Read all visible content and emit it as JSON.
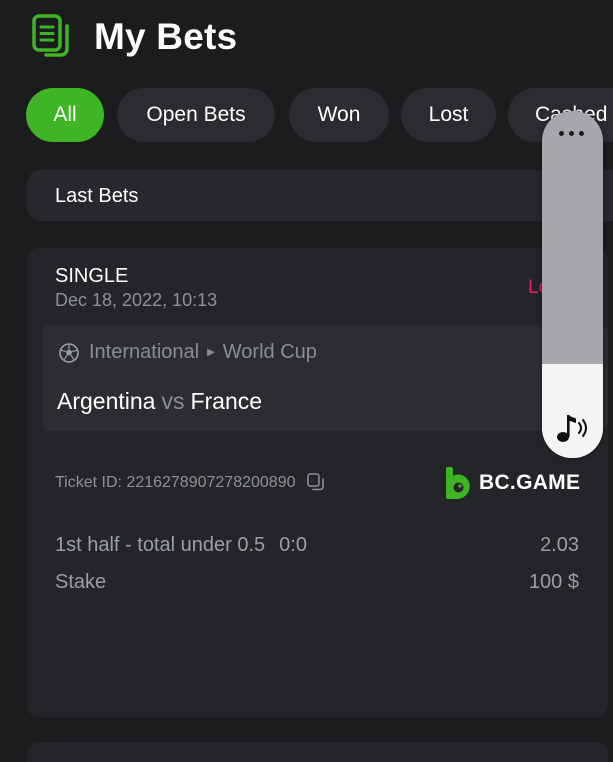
{
  "header": {
    "title": "My Bets",
    "icon": "bets-document-icon"
  },
  "tabs": [
    {
      "label": "All",
      "active": true
    },
    {
      "label": "Open Bets",
      "active": false
    },
    {
      "label": "Won",
      "active": false
    },
    {
      "label": "Lost",
      "active": false
    },
    {
      "label": "Cashed Out",
      "active": false
    }
  ],
  "section": {
    "label": "Last Bets"
  },
  "bet": {
    "type": "SINGLE",
    "date": "Dec 18, 2022, 10:13",
    "status": "Lost",
    "league": {
      "sport_icon": "soccer-ball-icon",
      "category": "International",
      "tournament": "World Cup"
    },
    "teams": {
      "home": "Argentina",
      "vs": "vs",
      "away": "France"
    },
    "ticket_id": "Ticket ID: 2216278907278200890",
    "brand": "BC.GAME",
    "selection": {
      "market": "1st half - total under 0.5",
      "score": "0:0",
      "odds": "2.03"
    },
    "stake": {
      "label": "Stake",
      "value": "100 $"
    }
  },
  "volume_overlay": {
    "level_fraction": 0.27,
    "icon": "music-note-icon"
  },
  "colors": {
    "accent": "#3fb425",
    "background": "#1b1c1e",
    "card": "#242528",
    "lost": "#e0206e"
  }
}
